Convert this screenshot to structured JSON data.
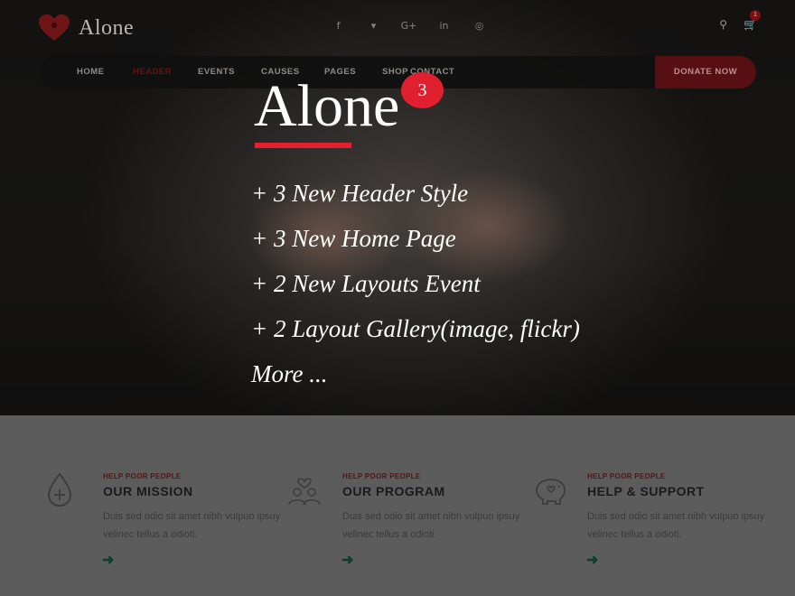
{
  "brand": {
    "name": "Alone",
    "accent": "#e5202e"
  },
  "social": [
    {
      "name": "facebook-icon",
      "glyph": "f"
    },
    {
      "name": "twitter-icon",
      "glyph": "🐦"
    },
    {
      "name": "google-plus-icon",
      "glyph": "G+"
    },
    {
      "name": "linkedin-icon",
      "glyph": "in"
    },
    {
      "name": "dribbble-icon",
      "glyph": "◎"
    }
  ],
  "cart": {
    "count": "1"
  },
  "nav": {
    "items": [
      "HOME",
      "HEADER",
      "EVENTS",
      "CAUSES",
      "PAGES",
      "SHOP",
      "CONTACT"
    ],
    "active": "HEADER",
    "donate_label": "DONATE NOW"
  },
  "hero": {
    "title": "Alone",
    "badge": "3",
    "features": [
      "+ 3 New Header Style",
      "+ 3 New Home Page",
      "+ 2 New Layouts Event",
      "+ 2 Layout Gallery(image, flickr)",
      "More ..."
    ]
  },
  "cards": [
    {
      "icon": "water-drop-plus-icon",
      "kicker": "HELP POOR PEOPLE",
      "title": "OUR MISSION",
      "desc": "Duis sed odio sit amet nibh vulpuo ipsuy velinec tellus a odioti.",
      "arrow": "➜"
    },
    {
      "icon": "people-heart-icon",
      "kicker": "HELP POOR PEOPLE",
      "title": "OUR PROGRAM",
      "desc": "Duis sed odio sit amet nibh vulpuo ipsuy velinec tellus a odioti.",
      "arrow": "➜"
    },
    {
      "icon": "piggy-bank-icon",
      "kicker": "HELP POOR PEOPLE",
      "title": "HELP & SUPPORT",
      "desc": "Duis sed odio sit amet nibh vulpuo ipsuy velinec tellus a odioti.",
      "arrow": "➜"
    }
  ]
}
